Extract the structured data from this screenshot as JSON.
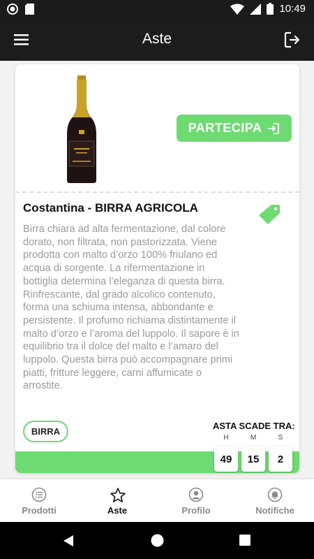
{
  "status_bar": {
    "time": "10:49"
  },
  "app_bar": {
    "title": "Aste"
  },
  "product": {
    "title": "Costantina - BIRRA AGRICOLA",
    "description": "Birra chiara ad alta fermentazione, dal colore dorato, non filtrata, non pastorizzata. Viene prodotta con malto d’orzo 100% friulano ed acqua di sorgente. La rifermentazione in bottiglia determina l’eleganza di questa birra. Rinfrescante, dal grado alcolico contenuto, forma una schiuma intensa, abbondante e persistente. Il profumo richiama distintamente il malto d’orzo e l’aroma del luppolo. Il sapore è in equilibrio tra il dolce del malto e l’amaro del luppolo. Questa birra può accompagnare primi piatti, fritture leggere, carni affumicate o arrostite.",
    "participate_label": "PARTECIPA",
    "category": "BIRRA"
  },
  "auction": {
    "expire_label": "ASTA SCADE TRA:",
    "timer": [
      {
        "unit": "H",
        "value": "49"
      },
      {
        "unit": "M",
        "value": "15"
      },
      {
        "unit": "S",
        "value": "2"
      }
    ]
  },
  "bottom_nav": {
    "items": [
      {
        "label": "Prodotti",
        "icon": "list-icon"
      },
      {
        "label": "Aste",
        "icon": "star-icon",
        "active": true
      },
      {
        "label": "Profilo",
        "icon": "profile-icon"
      },
      {
        "label": "Notifiche",
        "icon": "bell-icon"
      }
    ]
  },
  "colors": {
    "accent": "#6ddb72",
    "app_bar": "#1c1c1c",
    "background": "#f2f2f2"
  }
}
